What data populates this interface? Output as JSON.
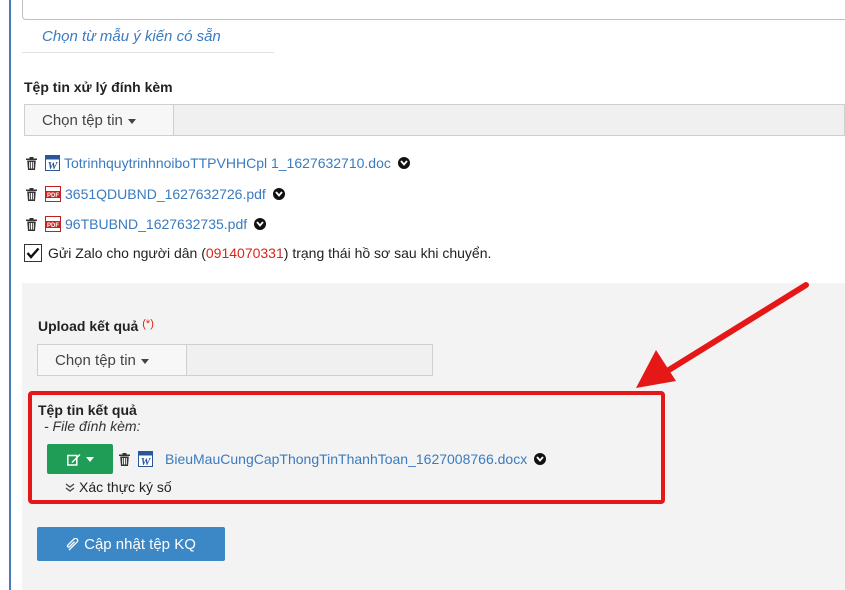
{
  "opinion": {
    "template_link": "Chọn từ mẫu ý kiến có sẵn"
  },
  "attachments": {
    "title": "Tệp tin xử lý đính kèm",
    "picker_label": "Chọn tệp tin",
    "files": [
      {
        "name": "TotrinhquytrinhnoiboTTPVHHCpl 1_1627632710.doc",
        "type": "word"
      },
      {
        "name": "3651QDUBND_1627632726.pdf",
        "type": "pdf"
      },
      {
        "name": "96TBUBND_1627632735.pdf",
        "type": "pdf"
      }
    ]
  },
  "zalo": {
    "checked": true,
    "prefix": "Gửi Zalo cho người dân (",
    "phone": "0914070331",
    "suffix": ") trạng thái hồ sơ sau khi chuyển."
  },
  "upload": {
    "title": "Upload kết quả",
    "required_mark": "(*)",
    "picker_label": "Chọn tệp tin"
  },
  "result_files": {
    "title": "Tệp tin kết quả",
    "subtitle": "- File đính kèm:",
    "file_name": "BieuMauCungCapThongTinThanhToan_1627008766.docx",
    "verify_label": "Xác thực ký số"
  },
  "update_button": {
    "label": "Cập nhật tệp KQ"
  },
  "colors": {
    "accent_red": "#e61717",
    "link_blue": "#3a7bbf",
    "green": "#1f9d57",
    "button_blue": "#3c87c6"
  }
}
